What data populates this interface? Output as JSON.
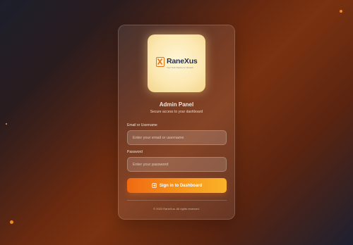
{
  "brand": {
    "name_prefix": "Rane",
    "name_suffix": "Xus",
    "tagline": "Your Tech Partner in Growth"
  },
  "header": {
    "title": "Admin Panel",
    "subtitle": "Secure access to your dashboard"
  },
  "form": {
    "email_label": "Email or Username",
    "email_placeholder": "Enter your email or username",
    "email_value": "",
    "password_label": "Password",
    "password_placeholder": "Enter your password",
    "password_value": "",
    "submit_label": "Sign in to Dashboard",
    "submit_icon": "login-icon"
  },
  "footer": {
    "text": "© 2023 RaneXus. All rights reserved."
  },
  "colors": {
    "accent": "#f58a1a",
    "brand_navy": "#1f2d5a"
  }
}
